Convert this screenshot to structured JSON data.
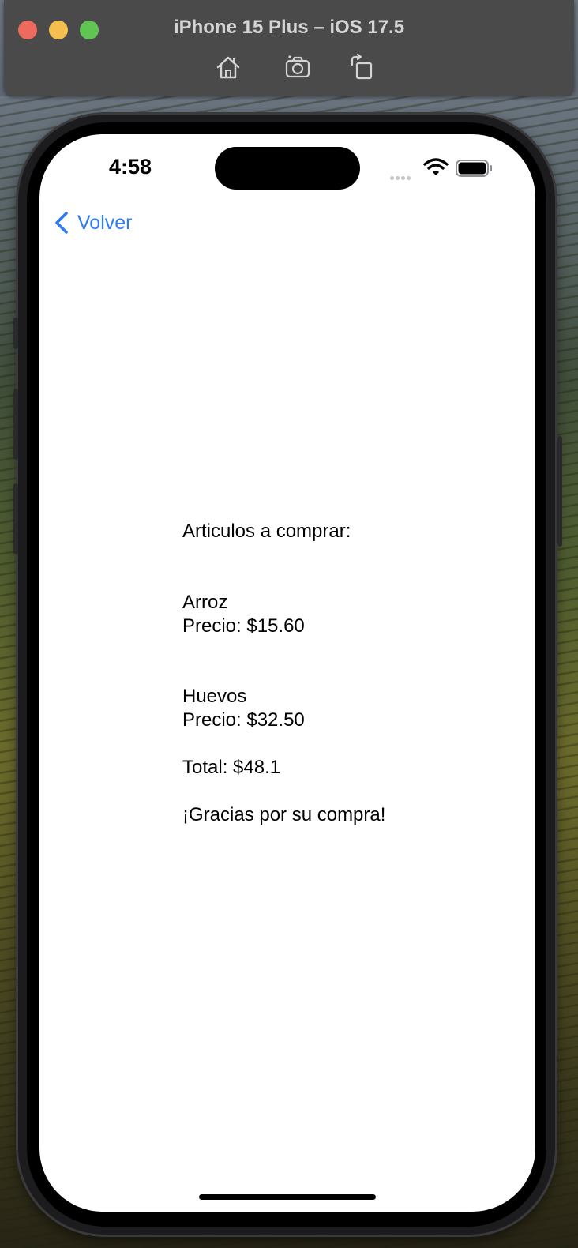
{
  "window": {
    "title": "iPhone 15 Plus – iOS 17.5",
    "toolbar_icons": [
      "home-icon",
      "screenshot-icon",
      "rotate-icon"
    ]
  },
  "status_bar": {
    "time": "4:58",
    "icons": [
      "cellular-signal-icon",
      "wifi-icon",
      "battery-icon"
    ]
  },
  "nav": {
    "back_label": "Volver",
    "accent_color": "#2f7bf5"
  },
  "purchase": {
    "heading": "Articulos a comprar:",
    "items": [
      {
        "name": "Arroz",
        "price_label": "Precio: $15.60"
      },
      {
        "name": "Huevos",
        "price_label": "Precio: $32.50"
      }
    ],
    "total_label": "Total: $48.1",
    "thanks": "¡Gracias por su compra!"
  }
}
